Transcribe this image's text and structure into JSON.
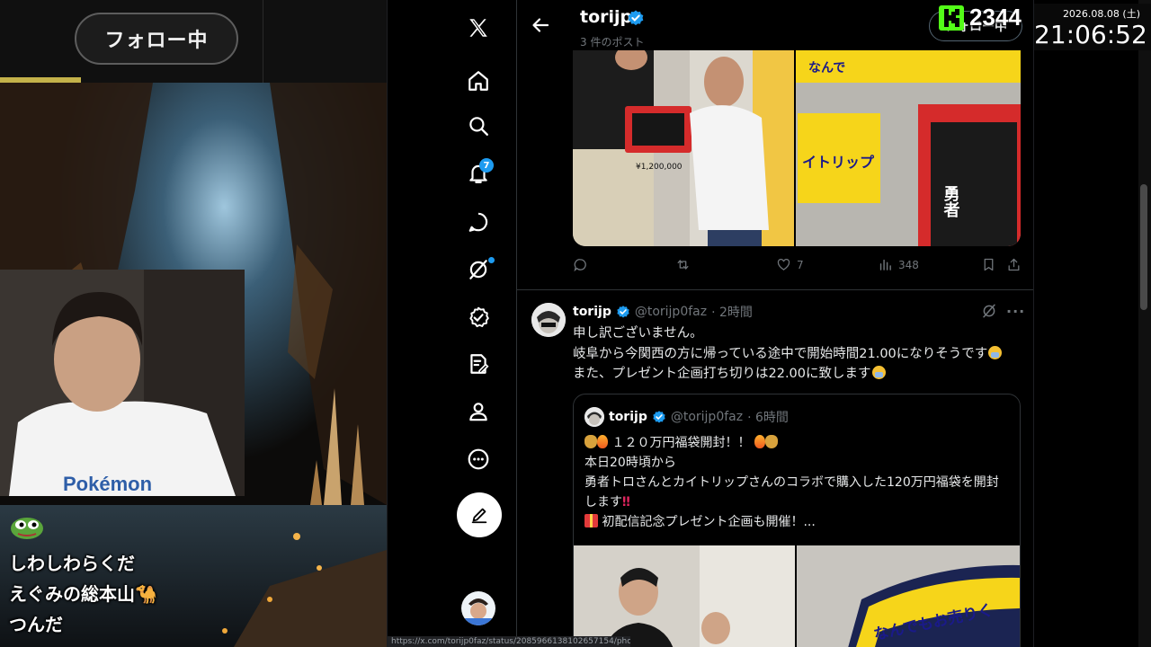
{
  "stream": {
    "follow_overlay_label": "フォロー中",
    "chat_messages": [
      {
        "text": "しわしわらくだ"
      },
      {
        "text": "えぐみの総本山🐪"
      },
      {
        "text": "つんだ"
      }
    ],
    "viewer_count": "2344",
    "clock": {
      "date": "2026.08.08 (土)",
      "time": "21:06:52"
    }
  },
  "x": {
    "nav": [
      {
        "icon": "x-logo-icon"
      },
      {
        "icon": "home-icon"
      },
      {
        "icon": "search-icon"
      },
      {
        "icon": "notifications-icon",
        "badge": "7"
      },
      {
        "icon": "messages-icon"
      },
      {
        "icon": "grok-icon"
      },
      {
        "icon": "communities-icon"
      },
      {
        "icon": "premium-icon"
      },
      {
        "icon": "profile-icon"
      },
      {
        "icon": "more-icon"
      }
    ],
    "header": {
      "name": "torijp",
      "post_count": "3 件のポスト",
      "follow_label": "フォロー中"
    },
    "post1_actions": {
      "replies": "",
      "reposts": "",
      "likes": "7",
      "views": "348"
    },
    "post2": {
      "name": "torijp",
      "handle": "@torijp0faz",
      "time": "· 2時間",
      "lines": [
        "申し訳ございません。",
        "岐阜から今関西の方に帰っている途中で開始時間21.00になりそうです",
        "また、プレゼント企画打ち切りは22.00に致します"
      ]
    },
    "quote": {
      "name": "torijp",
      "handle": "@torijp0faz",
      "time": "· 6時間",
      "title_line": "１２０万円福袋開封！！",
      "lines": [
        "本日20時頃から",
        "勇者トロさんとカイトリップさんのコラボで購入した120万円福袋を開封",
        "します",
        "初配信記念プレゼント企画も開催！..."
      ]
    },
    "media_texts": {
      "sign_top": "なんでもお売りく",
      "shop_sign": "イトリップ",
      "bag_text": "勇者トロ",
      "price_tag": "¥1,200,000"
    },
    "status_url": "https://x.com/torijp0faz/status/2085966138102657154/photo/1"
  },
  "colors": {
    "accent_blue": "#1d9bf0",
    "kick_green": "#53fc18"
  }
}
